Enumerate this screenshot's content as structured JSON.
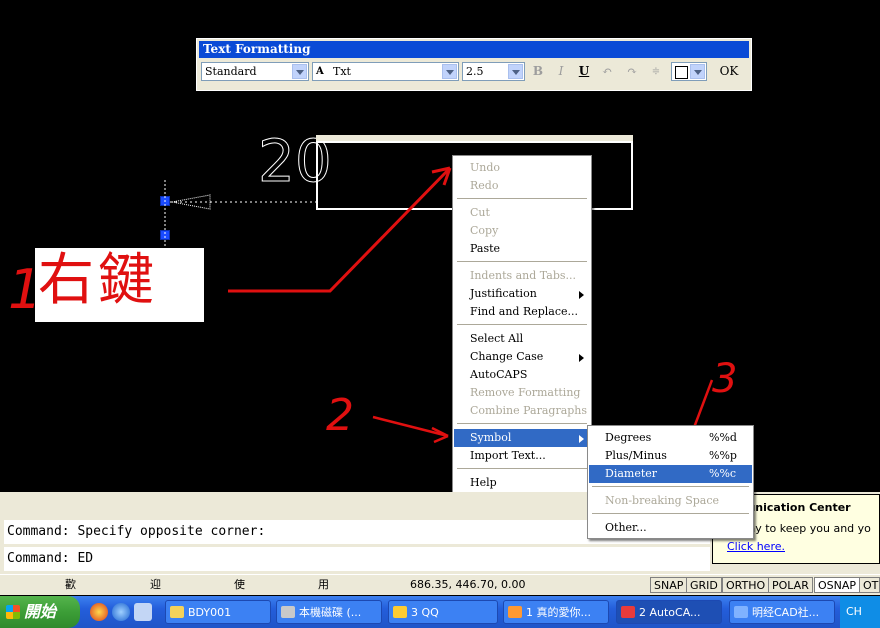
{
  "toolbar": {
    "title": "Text Formatting",
    "style": "Standard",
    "font": "Txt",
    "font_icon": "truetype-font-icon",
    "height": "2.5",
    "bold": "B",
    "italic": "I",
    "underline": "U",
    "ok": "OK"
  },
  "label": {
    "step1": "1",
    "text": "右鍵",
    "step2": "2",
    "step3": "3"
  },
  "canvas_text": "20",
  "context_menu": {
    "items": [
      {
        "label": "Undo",
        "disabled": true
      },
      {
        "label": "Redo",
        "disabled": true
      },
      {
        "label": "Cut",
        "disabled": true
      },
      {
        "label": "Copy",
        "disabled": true
      },
      {
        "label": "Paste",
        "disabled": false
      },
      {
        "label": "Indents and Tabs...",
        "disabled": true
      },
      {
        "label": "Justification",
        "disabled": false,
        "submenu": true
      },
      {
        "label": "Find and Replace...",
        "disabled": false
      },
      {
        "label": "Select All",
        "disabled": false
      },
      {
        "label": "Change Case",
        "disabled": false,
        "submenu": true
      },
      {
        "label": "AutoCAPS",
        "disabled": false
      },
      {
        "label": "Remove Formatting",
        "disabled": true
      },
      {
        "label": "Combine Paragraphs",
        "disabled": true
      },
      {
        "label": "Symbol",
        "disabled": false,
        "submenu": true,
        "highlighted": true
      },
      {
        "label": "Import Text...",
        "disabled": false
      },
      {
        "label": "Help",
        "disabled": false
      }
    ]
  },
  "symbol_menu": {
    "items": [
      {
        "label": "Degrees",
        "code": "%%d"
      },
      {
        "label": "Plus/Minus",
        "code": "%%p"
      },
      {
        "label": "Diameter",
        "code": "%%c",
        "highlighted": true
      },
      {
        "label": "Non-breaking Space",
        "code": "",
        "disabled": true
      },
      {
        "label": "Other...",
        "code": ""
      }
    ]
  },
  "command": {
    "line1": "Command: Specify opposite corner:",
    "line2": "Command: ED"
  },
  "comm_center": {
    "title": "ommunication Center",
    "body": "asy way to keep you and yo",
    "link": "Click here."
  },
  "status": {
    "layout_tabs": [
      "歡",
      "迎",
      "使",
      "用"
    ],
    "coords": "686.35, 446.70, 0.00",
    "buttons": [
      "SNAP",
      "GRID",
      "ORTHO",
      "POLAR",
      "OSNAP",
      "OTR"
    ]
  },
  "taskbar": {
    "start": "開始",
    "tasks": [
      {
        "label": "BDY001",
        "icon": "folder-icon",
        "color": "#f5d25a"
      },
      {
        "label": "本機磁碟 (...",
        "icon": "drive-icon",
        "color": "#c9c9c9"
      },
      {
        "label": "3 QQ",
        "icon": "qq-icon",
        "color": "#ffcc33"
      },
      {
        "label": "1 真的愛你...",
        "icon": "media-icon",
        "color": "#ff9933"
      },
      {
        "label": "2 AutoCA...",
        "icon": "autocad-icon",
        "color": "#e83b3b"
      },
      {
        "label": "明经CAD社...",
        "icon": "browser-icon",
        "color": "#7fb2ff"
      }
    ],
    "tray": "CH"
  }
}
